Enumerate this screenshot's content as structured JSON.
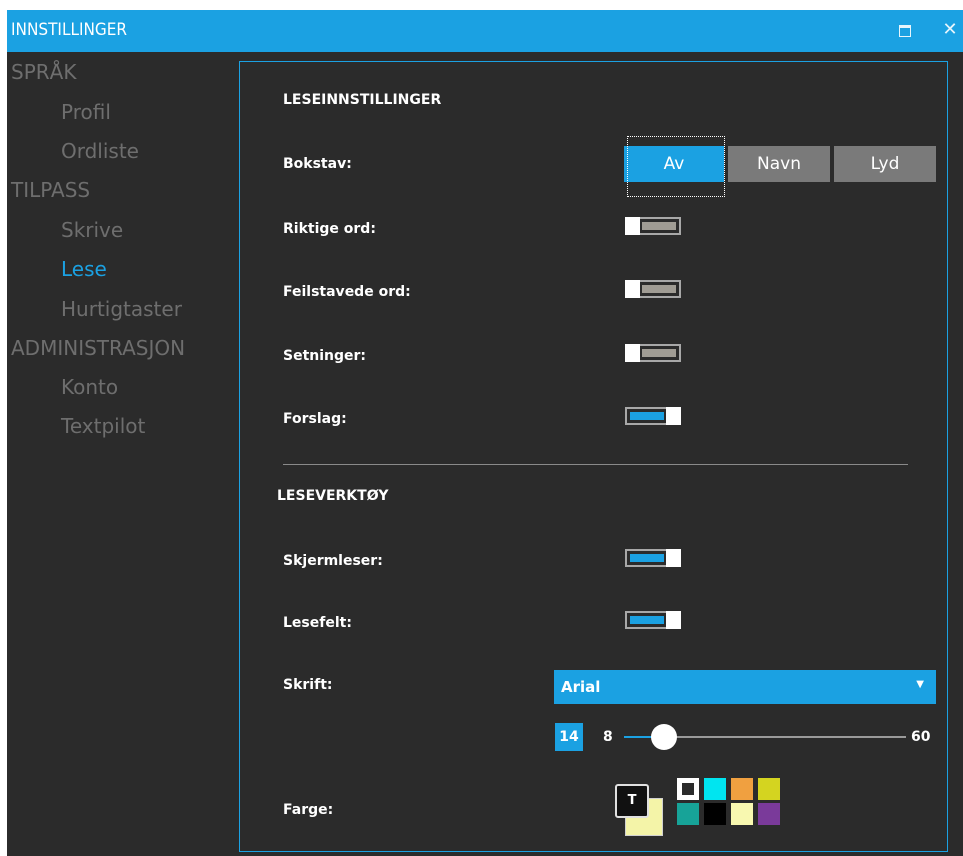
{
  "window": {
    "title": "INNSTILLINGER",
    "maximize_icon": "maximize-icon",
    "close_icon": "close-icon",
    "close_glyph": "✕"
  },
  "sidebar": {
    "items": [
      {
        "label": "SPRÅK",
        "level": "section",
        "active": false
      },
      {
        "label": "Profil",
        "level": "sub",
        "active": false
      },
      {
        "label": "Ordliste",
        "level": "sub",
        "active": false
      },
      {
        "label": "TILPASS",
        "level": "section",
        "active": false
      },
      {
        "label": "Skrive",
        "level": "sub",
        "active": false
      },
      {
        "label": "Lese",
        "level": "sub",
        "active": true
      },
      {
        "label": "Hurtigtaster",
        "level": "sub",
        "active": false
      },
      {
        "label": "ADMINISTRASJON",
        "level": "section",
        "active": false
      },
      {
        "label": "Konto",
        "level": "sub",
        "active": false
      },
      {
        "label": "Textpilot",
        "level": "sub",
        "active": false
      }
    ]
  },
  "reading": {
    "title": "LESEINNSTILLINGER",
    "bokstav": {
      "label": "Bokstav:",
      "options": [
        "Av",
        "Navn",
        "Lyd"
      ],
      "selected": "Av"
    },
    "riktige_ord": {
      "label": "Riktige ord:",
      "on": false
    },
    "feilstavede_ord": {
      "label": "Feilstavede ord:",
      "on": false
    },
    "setninger": {
      "label": "Setninger:",
      "on": false
    },
    "forslag": {
      "label": "Forslag:",
      "on": true
    }
  },
  "tools": {
    "title": "LESEVERKTØY",
    "skjermleser": {
      "label": "Skjermleser:",
      "on": true
    },
    "lesefelt": {
      "label": "Lesefelt:",
      "on": true
    },
    "skrift": {
      "label": "Skrift:",
      "value": "Arial",
      "caret": "▼"
    },
    "size": {
      "value": "14",
      "min": "8",
      "max": "60",
      "level": 8
    },
    "farge": {
      "label": "Farge:",
      "preview_glyph": "T",
      "preview_text_color": "#111111",
      "preview_bg_color": "#f4f4a8",
      "swatches": [
        "#ffffff",
        "#00e5f0",
        "#f0a040",
        "#d4d420",
        "#17a398",
        "#000000",
        "#f8f8b0",
        "#7a3a9a"
      ],
      "selected_swatch": "#ffffff"
    }
  },
  "colors": {
    "accent": "#1ba1e2",
    "background": "#2b2b2b",
    "sidebar_text": "#6e6e6e"
  }
}
